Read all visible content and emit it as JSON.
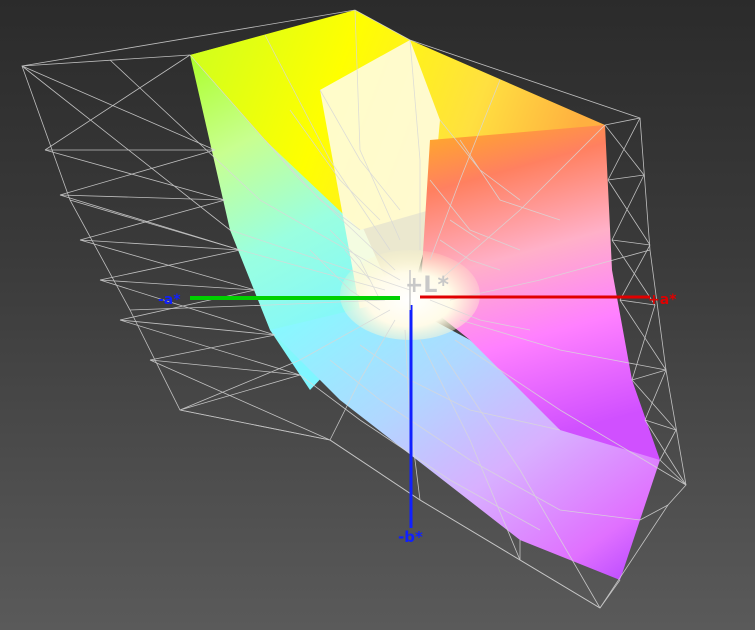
{
  "axes": {
    "l_plus": "+L*",
    "a_plus": "+a*",
    "a_minus": "-a*",
    "b_minus": "-b*"
  },
  "colors": {
    "background_top": "#2b2b2b",
    "background_bottom": "#5a5a5a",
    "wireframe": "#d8d8d8",
    "axis_a_plus": "#e00000",
    "axis_a_minus": "#00d000",
    "axis_b_minus": "#1020ff",
    "axis_l": "#c8c8c8"
  }
}
